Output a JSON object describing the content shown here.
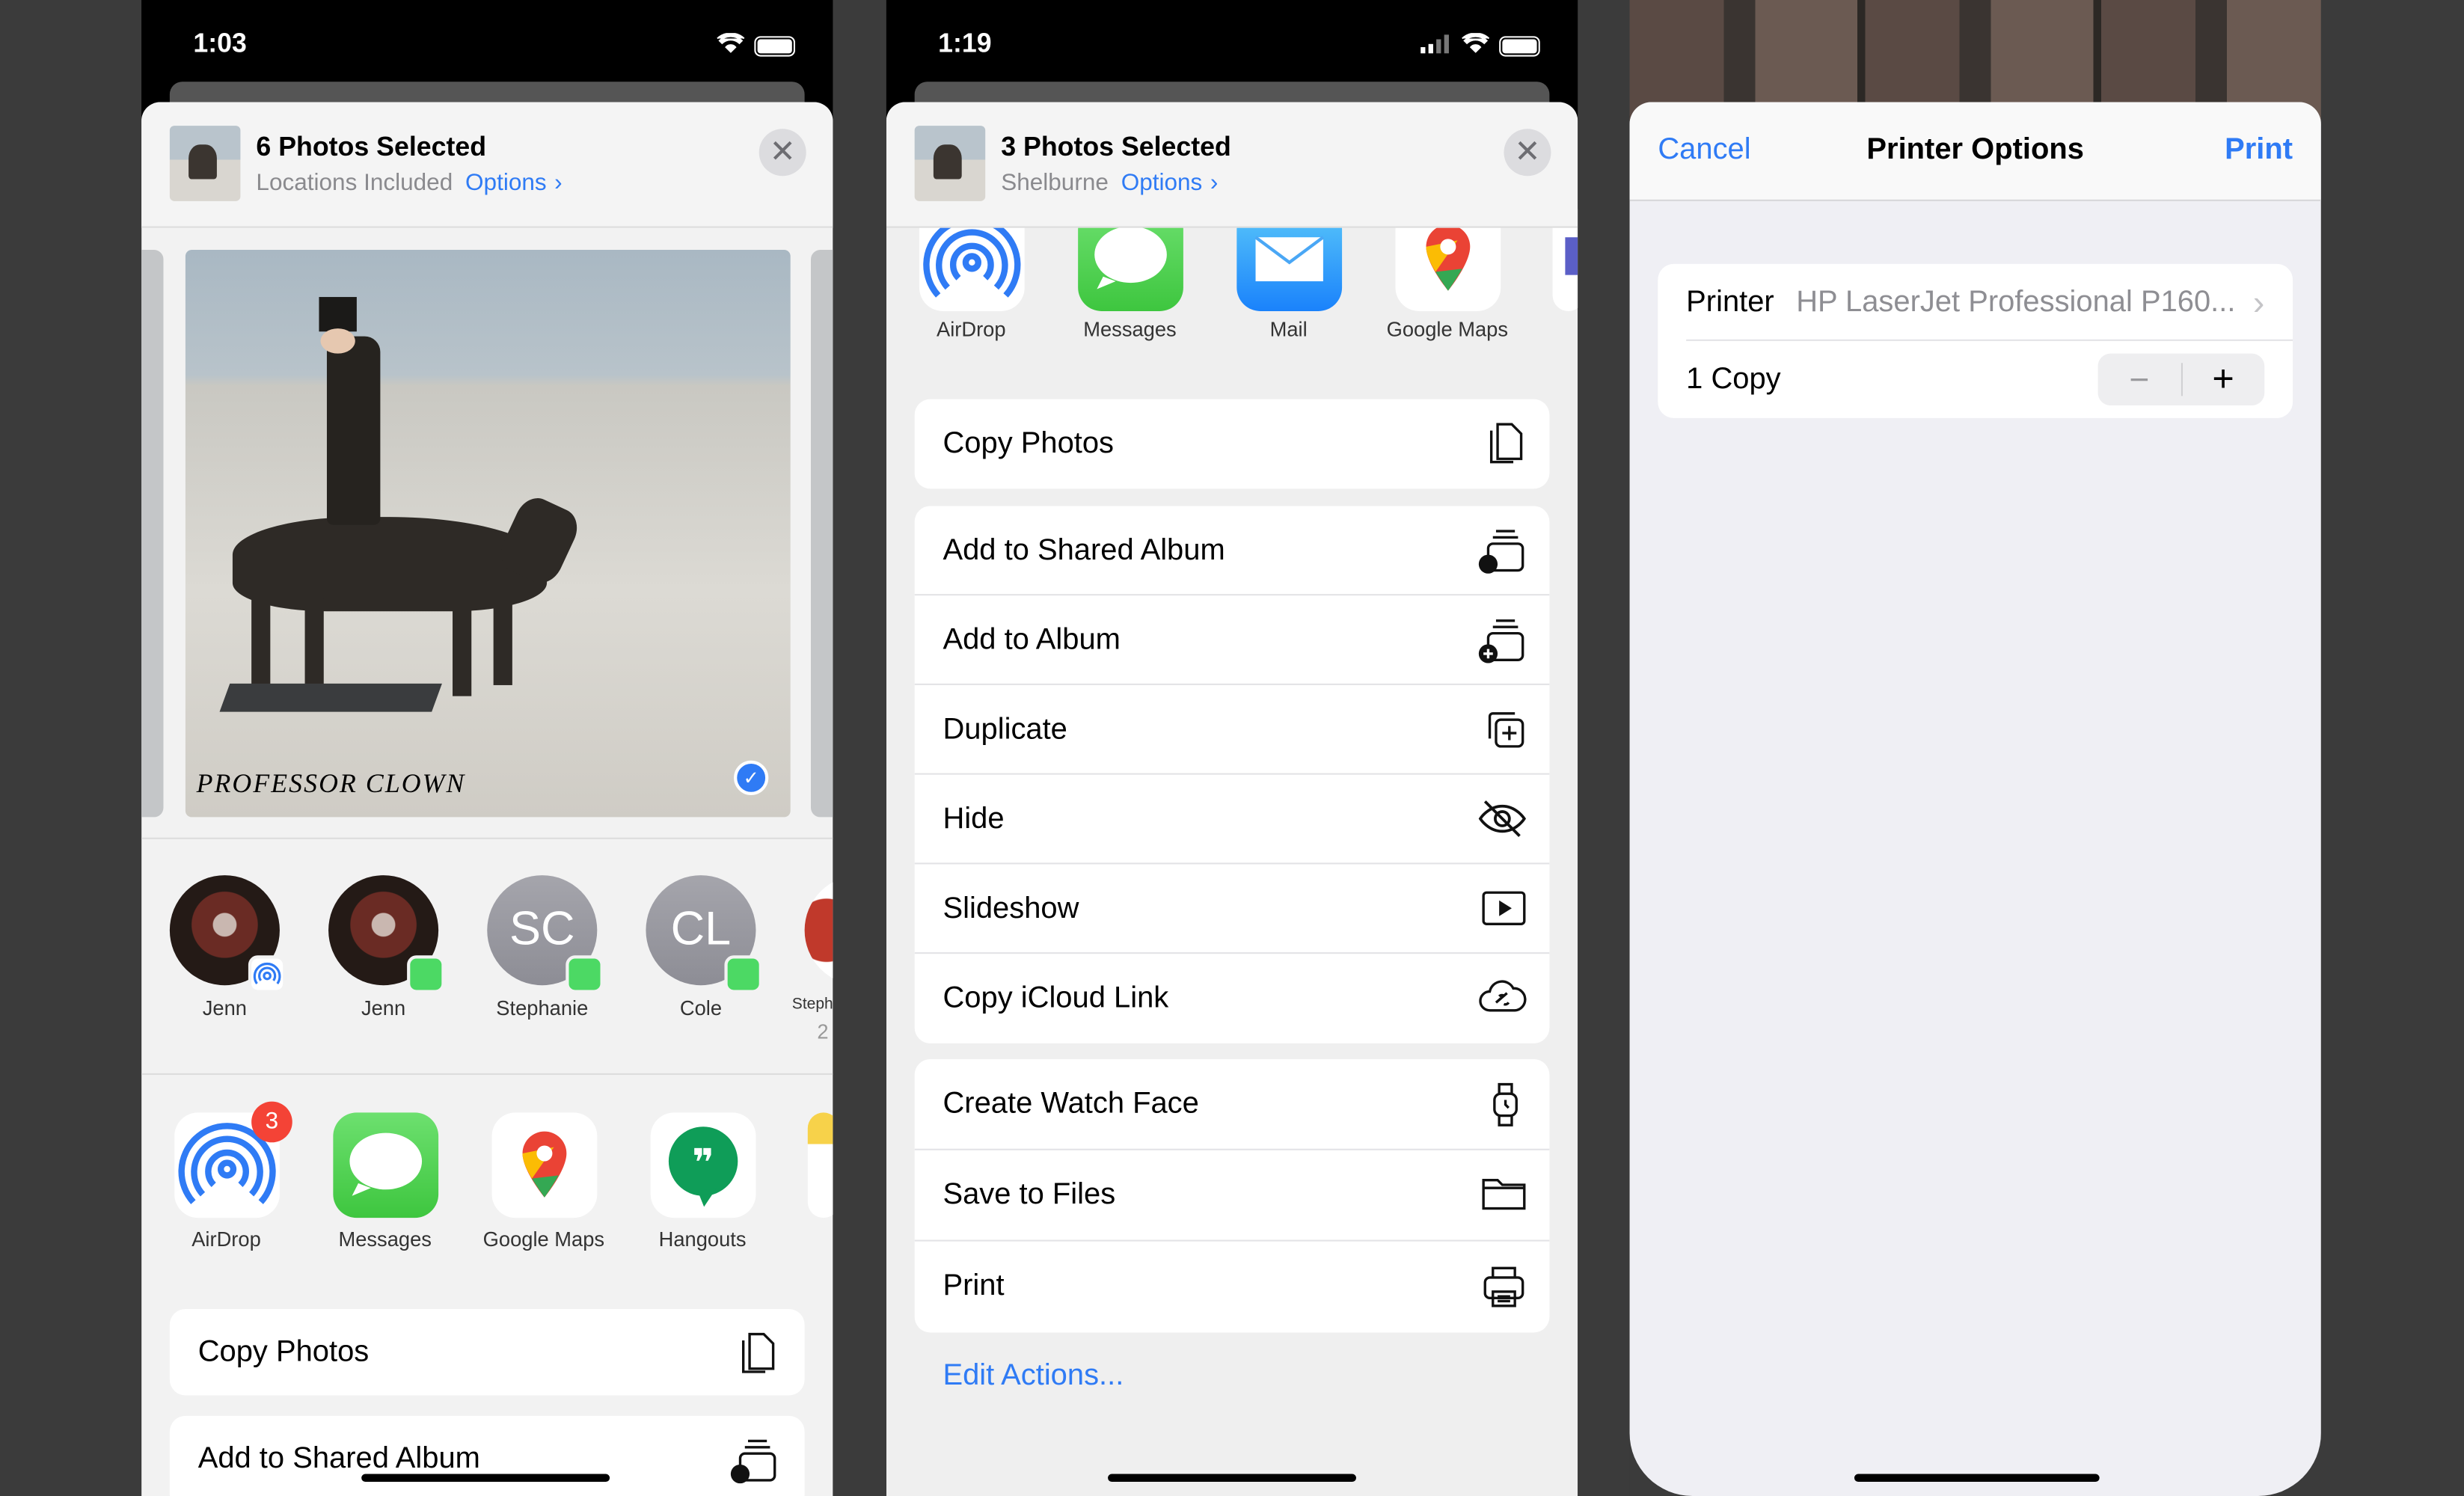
{
  "screens": [
    {
      "status_time": "1:03",
      "header": {
        "title": "6 Photos Selected",
        "subtitle": "Locations Included",
        "options_label": "Options"
      },
      "photo_caption": "PROFESSOR CLOWN",
      "people": [
        {
          "name": "Jenn",
          "badge": "airdrop"
        },
        {
          "name": "Jenn",
          "badge": "messages"
        },
        {
          "name": "Stephanie",
          "initials": "SC",
          "badge": "messages"
        },
        {
          "name": "Cole",
          "initials": "CL",
          "badge": "messages"
        },
        {
          "name": "Steph",
          "extra": "2"
        }
      ],
      "apps": [
        {
          "label": "AirDrop",
          "badge": "3"
        },
        {
          "label": "Messages"
        },
        {
          "label": "Google Maps"
        },
        {
          "label": "Hangouts"
        }
      ],
      "actions": [
        "Copy Photos",
        "Add to Shared Album"
      ]
    },
    {
      "status_time": "1:19",
      "header": {
        "title": "3 Photos Selected",
        "subtitle": "Shelburne",
        "options_label": "Options"
      },
      "apps": [
        {
          "label": "AirDrop"
        },
        {
          "label": "Messages"
        },
        {
          "label": "Mail"
        },
        {
          "label": "Google Maps"
        }
      ],
      "action_groups": [
        [
          "Copy Photos"
        ],
        [
          "Add to Shared Album",
          "Add to Album",
          "Duplicate",
          "Hide",
          "Slideshow",
          "Copy iCloud Link"
        ],
        [
          "Create Watch Face",
          "Save to Files",
          "Print"
        ]
      ],
      "edit_actions": "Edit Actions..."
    },
    {
      "nav": {
        "cancel": "Cancel",
        "title": "Printer Options",
        "print": "Print"
      },
      "printer_label": "Printer",
      "printer_value": "HP LaserJet Professional P160...",
      "copies": "1 Copy",
      "stepper": {
        "minus": "−",
        "plus": "+"
      }
    }
  ],
  "colors": {
    "accent": "#2f7bf5",
    "messages_green": "#4cd964",
    "badge_red": "#f44336"
  }
}
